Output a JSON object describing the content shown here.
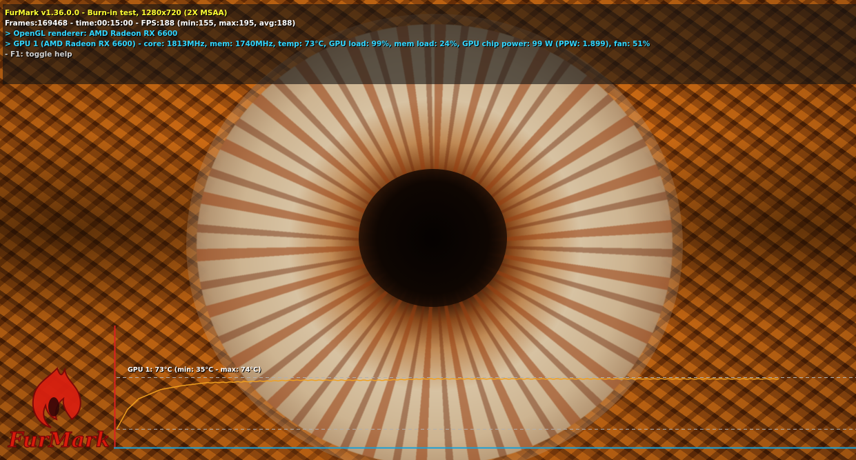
{
  "app": {
    "name": "FurMark",
    "logo_text": "FurMark"
  },
  "overlay": {
    "title_line": "FurMark v1.36.0.0 - Burn-in test, 1280x720 (2X MSAA)",
    "frames_line": "Frames:169468 - time:00:15:00 - FPS:188 (min:155, max:195, avg:188)",
    "renderer_line": "> OpenGL renderer: AMD Radeon RX 6600",
    "gpu_line": "> GPU 1 (AMD Radeon RX 6600) - core: 1813MHz, mem: 1740MHz, temp: 73°C, GPU load: 99%, mem load: 24%, GPU chip power: 99 W (PPW: 1.899), fan: 51%",
    "help_line": "- F1: toggle help"
  },
  "colors": {
    "title": "#ffff33",
    "frames": "#ffffff",
    "info": "#33d6ff",
    "help": "#d0d0d0",
    "graph_line": "#f0a020",
    "graph_axis_x": "#1aa0d8",
    "graph_axis_y": "#e02020",
    "graph_ref": "#b0b0b0"
  },
  "graph": {
    "label": "GPU 1: 73°C (min: 35°C - max: 74°C)",
    "current_temp_c": 73,
    "min_temp_c": 35,
    "max_temp_c": 74
  },
  "chart_data": {
    "type": "line",
    "title": "GPU 1: 73°C (min: 35°C - max: 74°C)",
    "series": [
      {
        "name": "GPU 1",
        "x": [
          0,
          0.25,
          0.5,
          1,
          1.5,
          2,
          3,
          4,
          5,
          6,
          7,
          8,
          9,
          10,
          11,
          12,
          13,
          14,
          15
        ],
        "values": [
          35,
          50,
          58,
          65,
          68,
          70,
          71,
          72,
          72,
          72,
          73,
          73,
          73,
          73,
          73,
          73,
          73,
          73,
          73
        ]
      }
    ],
    "xlim": [
      0,
      15
    ],
    "ylim": [
      30,
      80
    ],
    "grid": false
  }
}
